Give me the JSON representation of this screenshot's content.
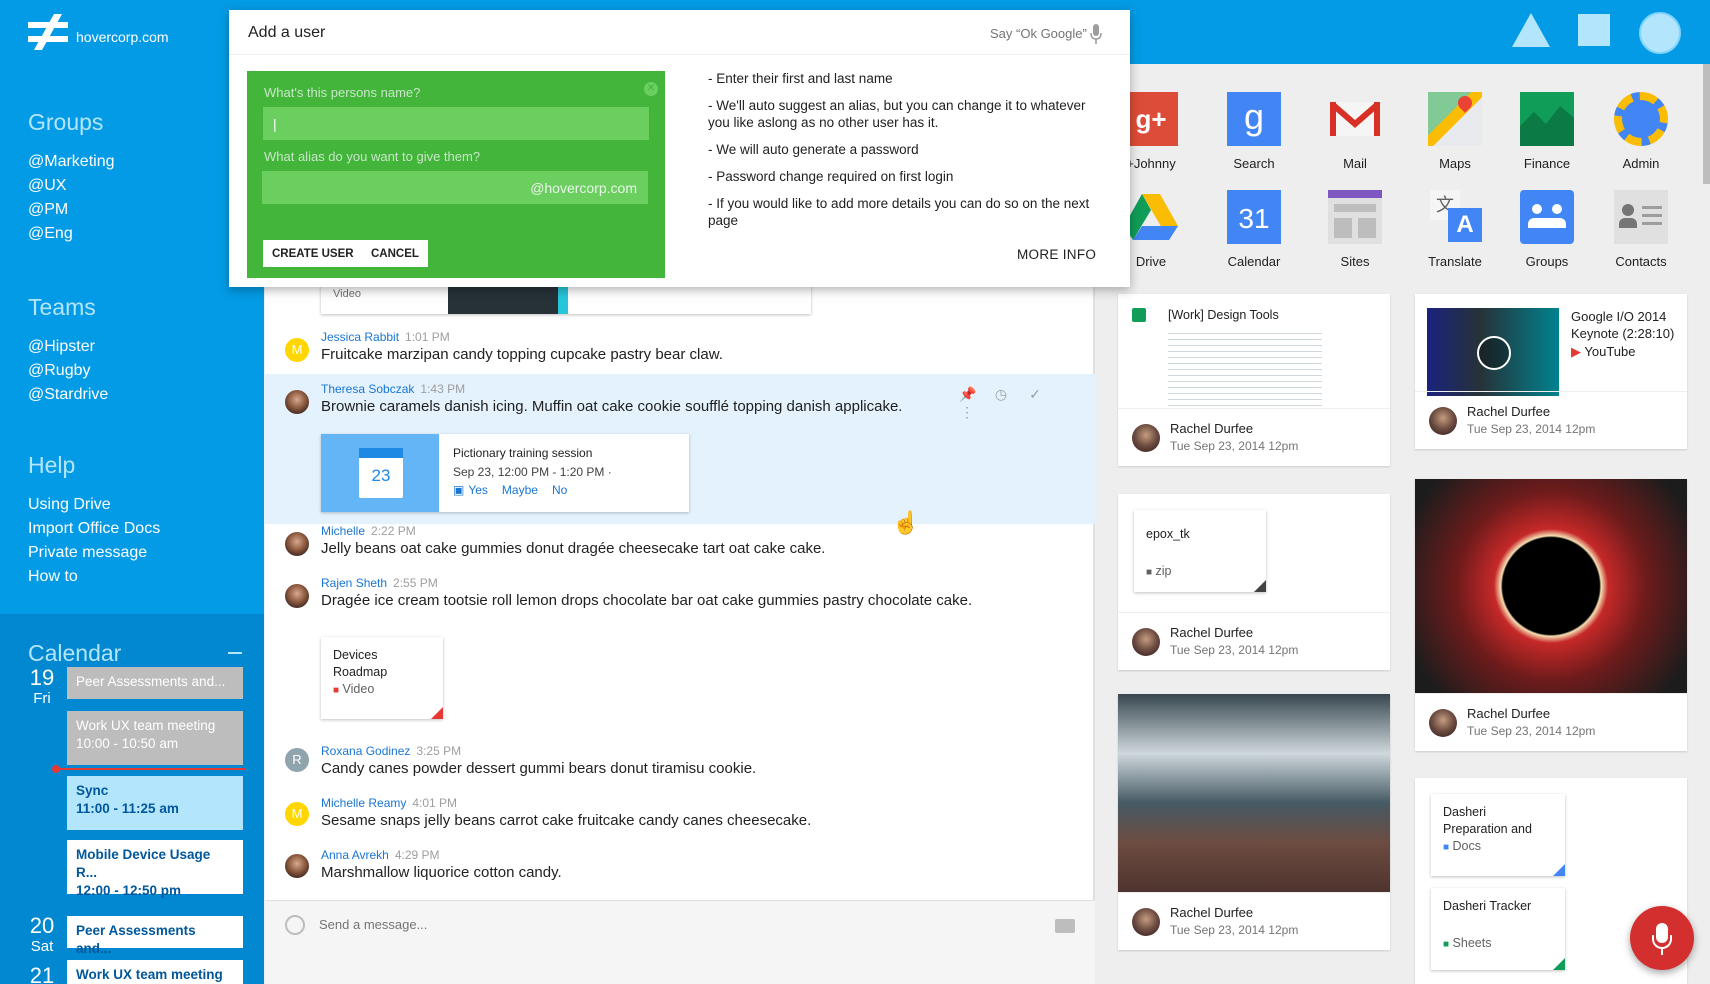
{
  "topbar": {
    "domain": "hovercorp.com"
  },
  "sidebar": {
    "groups": {
      "title": "Groups",
      "items": [
        "@Marketing",
        "@UX",
        "@PM",
        "@Eng"
      ]
    },
    "teams": {
      "title": "Teams",
      "items": [
        "@Hipster",
        "@Rugby",
        "@Stardrive"
      ]
    },
    "help": {
      "title": "Help",
      "items": [
        "Using Drive",
        "Import Office Docs",
        "Private message",
        "How to"
      ]
    },
    "calendar": {
      "title": "Calendar",
      "days": [
        {
          "num": "19",
          "wd": "Fri"
        },
        {
          "num": "20",
          "wd": "Sat"
        },
        {
          "num": "21",
          "wd": ""
        }
      ],
      "events": [
        {
          "title": "Peer Assessments and...",
          "time": ""
        },
        {
          "title": "Work UX team meeting",
          "time": "10:00 - 10:50 am"
        },
        {
          "title": "Sync",
          "time": "11:00 - 11:25 am"
        },
        {
          "title": "Mobile Device Usage R...",
          "time": "12:00 - 12:50 pm"
        },
        {
          "title": "Peer Assessments and...",
          "time": ""
        },
        {
          "title": "Work UX team meeting",
          "time": ""
        }
      ]
    }
  },
  "dialog": {
    "title": "Add a user",
    "ok_google": "Say “Ok Google”",
    "name_label": "What's this persons name?",
    "name_value": "|",
    "alias_label": "What alias do you want to give them?",
    "alias_value": "",
    "alias_suffix": "@hovercorp.com",
    "create_label": "CREATE USER",
    "cancel_label": "CANCEL",
    "tips": [
      "- Enter their first and last name",
      "- We'll auto suggest an alias, but you can change it to whatever you like aslong as no other user has it.",
      "- We will auto generate a password",
      "- Password change required on first login",
      "- If you would like to add more details you can do so on the next page"
    ],
    "more_info": "MORE INFO"
  },
  "chat": {
    "partial_card_label": "Video",
    "messages": [
      {
        "name": "Jessica Rabbit",
        "time": "1:01 PM",
        "text": "Fruitcake marzipan candy topping cupcake pastry bear claw.",
        "initial": "M"
      },
      {
        "name": "Theresa Sobczak",
        "time": "1:43 PM",
        "text": "Brownie caramels danish icing. Muffin oat cake cookie soufflé topping danish applicake.",
        "initial": ""
      },
      {
        "name": "Michelle",
        "time": "2:22 PM",
        "text": "Jelly beans oat cake gummies donut dragée cheesecake tart oat cake cake.",
        "initial": ""
      },
      {
        "name": "Rajen Sheth",
        "time": "2:55 PM",
        "text": "Dragée ice cream tootsie roll lemon drops chocolate bar oat cake gummies pastry chocolate cake.",
        "initial": ""
      },
      {
        "name": "Roxana Godinez",
        "time": "3:25 PM",
        "text": "Candy canes powder dessert gummi bears donut tiramisu cookie.",
        "initial": "R"
      },
      {
        "name": "Michelle Reamy",
        "time": "4:01 PM",
        "text": "Sesame snaps jelly beans carrot cake fruitcake candy canes cheesecake.",
        "initial": "M"
      },
      {
        "name": "Anna Avrekh",
        "time": "4:29 PM",
        "text": "Marshmallow liquorice cotton candy.",
        "initial": ""
      }
    ],
    "event": {
      "day": "23",
      "title": "Pictionary training session",
      "when": "Sep 23, 12:00 PM - 1:20 PM  ·",
      "yes": "Yes",
      "maybe": "Maybe",
      "no": "No"
    },
    "doc": {
      "line1": "Devices",
      "line2": "Roadmap",
      "type": "Video"
    },
    "input_placeholder": "Send a message..."
  },
  "apps": [
    {
      "label": "+Johnny",
      "icon": "google-plus-icon"
    },
    {
      "label": "Search",
      "icon": "google-search-icon"
    },
    {
      "label": "Mail",
      "icon": "gmail-icon"
    },
    {
      "label": "Maps",
      "icon": "maps-icon"
    },
    {
      "label": "Finance",
      "icon": "finance-icon"
    },
    {
      "label": "Admin",
      "icon": "admin-gear-icon"
    },
    {
      "label": "Drive",
      "icon": "drive-icon"
    },
    {
      "label": "Calendar",
      "icon": "calendar-icon",
      "badge": "31"
    },
    {
      "label": "Sites",
      "icon": "sites-icon"
    },
    {
      "label": "Translate",
      "icon": "translate-icon"
    },
    {
      "label": "Groups",
      "icon": "groups-icon"
    },
    {
      "label": "Contacts",
      "icon": "contacts-icon"
    }
  ],
  "cards": {
    "sheet": {
      "title": "[Work] Design Tools",
      "name": "Rachel Durfee",
      "date": "Tue Sep 23, 2014 12pm"
    },
    "youtube": {
      "title": "Google I/O 2014 Keynote (2:28:10)",
      "source": "YouTube",
      "name": "Rachel Durfee",
      "date": "Tue Sep 23, 2014 12pm"
    },
    "zip": {
      "title": "epox_tk",
      "type": "zip",
      "name": "Rachel Durfee",
      "date": "Tue Sep 23, 2014 12pm"
    },
    "eclipse": {
      "name": "Rachel Durfee",
      "date": "Tue Sep 23, 2014 12pm"
    },
    "boat": {
      "name": "Rachel Durfee",
      "date": "Tue Sep 23, 2014 12pm"
    },
    "dasheri1": {
      "line1": "Dasheri",
      "line2": "Preparation and",
      "type": "Docs"
    },
    "dasheri2": {
      "line1": "Dasheri Tracker",
      "type": "Sheets"
    }
  },
  "colors": {
    "primary": "#039be5",
    "dialog_green": "#43b53a",
    "accent_red": "#d32f2f"
  }
}
